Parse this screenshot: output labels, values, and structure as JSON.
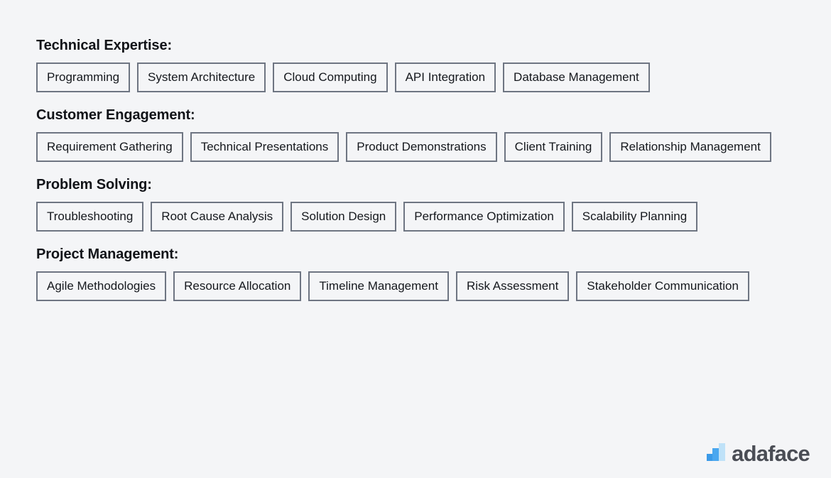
{
  "page": {
    "background_color": "#f4f5f7",
    "text_color": "#111318",
    "tag_border_color": "#6e7582"
  },
  "sections": [
    {
      "heading": "Technical Expertise:",
      "tags": [
        "Programming",
        "System Architecture",
        "Cloud Computing",
        "API Integration",
        "Database Management"
      ]
    },
    {
      "heading": "Customer Engagement:",
      "tags": [
        "Requirement Gathering",
        "Technical Presentations",
        "Product Demonstrations",
        "Client Training",
        "Relationship Management"
      ]
    },
    {
      "heading": "Problem Solving:",
      "tags": [
        "Troubleshooting",
        "Root Cause Analysis",
        "Solution Design",
        "Performance Optimization",
        "Scalability Planning"
      ]
    },
    {
      "heading": "Project Management:",
      "tags": [
        "Agile Methodologies",
        "Resource Allocation",
        "Timeline Management",
        "Risk Assessment",
        "Stakeholder Communication"
      ]
    }
  ],
  "logo": {
    "text": "adaface",
    "mark_icon": "bar-chart-icon",
    "mark_colors": [
      "#3b9ae8",
      "#4aa7ef",
      "#bfe2f8"
    ],
    "text_color": "#4a4d55"
  }
}
